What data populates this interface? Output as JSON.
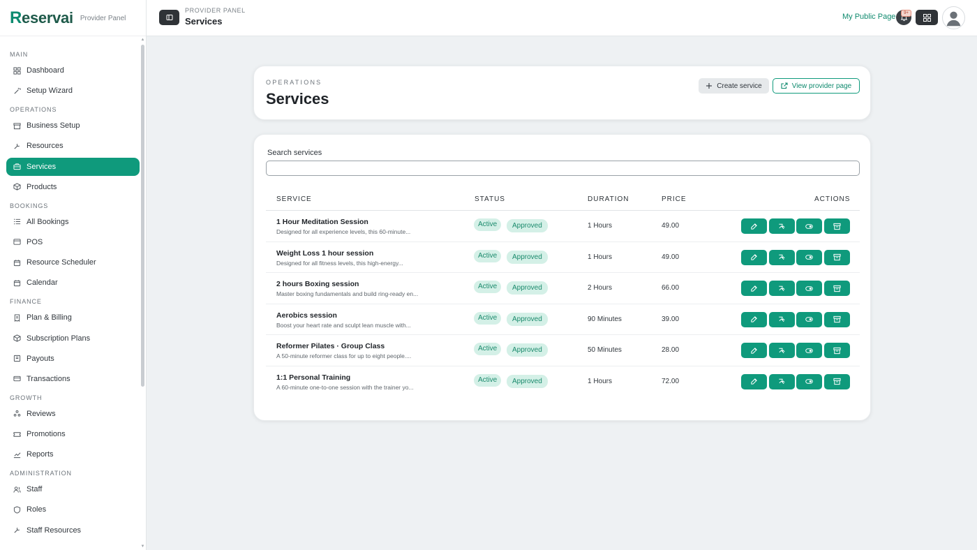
{
  "brand": {
    "name": "Reservai",
    "subtitle": "Provider Panel"
  },
  "header": {
    "crumb_top": "PROVIDER PANEL",
    "crumb_title": "Services",
    "public_link": "My Public Page",
    "notification_badge": "9+"
  },
  "sidebar": {
    "sections": [
      {
        "label": "MAIN",
        "items": [
          {
            "label": "Dashboard",
            "icon": "grid-icon"
          },
          {
            "label": "Setup Wizard",
            "icon": "wand-icon"
          }
        ]
      },
      {
        "label": "OPERATIONS",
        "items": [
          {
            "label": "Business Setup",
            "icon": "store-icon"
          },
          {
            "label": "Resources",
            "icon": "tools-icon"
          },
          {
            "label": "Services",
            "icon": "briefcase-icon",
            "active": true
          },
          {
            "label": "Products",
            "icon": "box-icon"
          }
        ]
      },
      {
        "label": "BOOKINGS",
        "items": [
          {
            "label": "All Bookings",
            "icon": "list-icon"
          },
          {
            "label": "POS",
            "icon": "terminal-icon"
          },
          {
            "label": "Resource Scheduler",
            "icon": "calendar-icon"
          },
          {
            "label": "Calendar",
            "icon": "calendar-icon"
          }
        ]
      },
      {
        "label": "FINANCE",
        "items": [
          {
            "label": "Plan & Billing",
            "icon": "receipt-icon"
          },
          {
            "label": "Subscription Plans",
            "icon": "box-icon"
          },
          {
            "label": "Payouts",
            "icon": "wallet-icon"
          },
          {
            "label": "Transactions",
            "icon": "card-icon"
          }
        ]
      },
      {
        "label": "GROWTH",
        "items": [
          {
            "label": "Reviews",
            "icon": "people-icon"
          },
          {
            "label": "Promotions",
            "icon": "ticket-icon"
          },
          {
            "label": "Reports",
            "icon": "chart-icon"
          }
        ]
      },
      {
        "label": "ADMINISTRATION",
        "items": [
          {
            "label": "Staff",
            "icon": "users-icon"
          },
          {
            "label": "Roles",
            "icon": "shield-icon"
          },
          {
            "label": "Staff Resources",
            "icon": "tools-icon"
          }
        ]
      }
    ]
  },
  "page": {
    "section_label": "OPERATIONS",
    "title": "Services",
    "create_label": "Create service",
    "view_label": "View provider page"
  },
  "search": {
    "label": "Search services",
    "value": "",
    "placeholder": ""
  },
  "table": {
    "columns": [
      "SERVICE",
      "STATUS",
      "DURATION",
      "PRICE",
      "ACTIONS"
    ],
    "rows": [
      {
        "name": "1 Hour Meditation Session",
        "desc": "Designed for all experience levels, this 60-minute...",
        "status": "Active",
        "approval": "Approved",
        "duration": "1 Hours",
        "price": "49.00"
      },
      {
        "name": "Weight Loss 1 hour session",
        "desc": "Designed for all fitness levels, this high-energy...",
        "status": "Active",
        "approval": "Approved",
        "duration": "1 Hours",
        "price": "49.00"
      },
      {
        "name": "2 hours Boxing session",
        "desc": "Master boxing fundamentals and build ring-ready en...",
        "status": "Active",
        "approval": "Approved",
        "duration": "2 Hours",
        "price": "66.00"
      },
      {
        "name": "Aerobics session",
        "desc": "Boost your heart rate and sculpt lean muscle with...",
        "status": "Active",
        "approval": "Approved",
        "duration": "90 Minutes",
        "price": "39.00"
      },
      {
        "name": "Reformer Pilates · Group Class",
        "desc": "A 50-minute reformer class for up to eight people....",
        "status": "Active",
        "approval": "Approved",
        "duration": "50 Minutes",
        "price": "28.00"
      },
      {
        "name": "1:1 Personal Training",
        "desc": "A 60-minute one-to-one session with the trainer yo...",
        "status": "Active",
        "approval": "Approved",
        "duration": "1 Hours",
        "price": "72.00"
      }
    ]
  },
  "colors": {
    "accent": "#0f9a7c",
    "dark": "#2f3337",
    "badge_bg": "#d4f0e7",
    "page_bg": "#eef1f3"
  }
}
